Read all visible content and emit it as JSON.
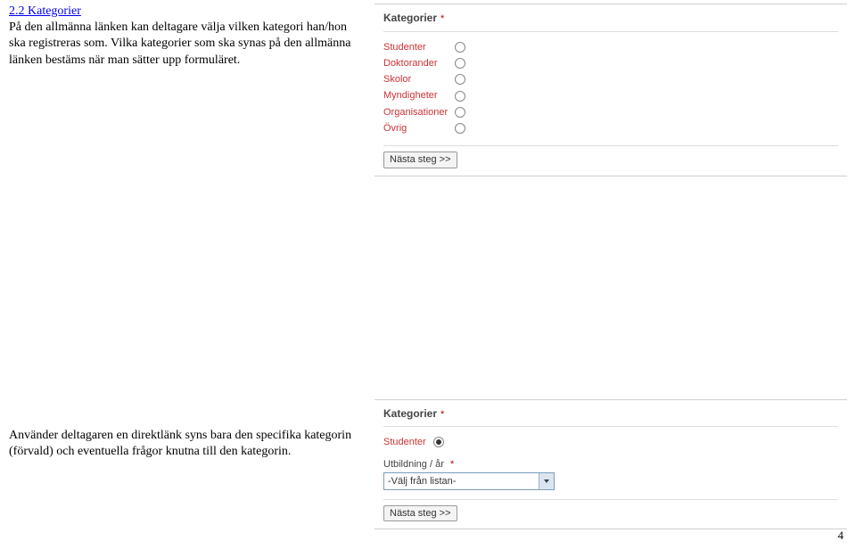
{
  "section_heading": "2.2 Kategorier",
  "paragraph1": "På den allmänna länken kan deltagare välja vilken kategori han/hon ska registreras som. Vilka kategorier som ska synas på den allmänna länken bestäms när man sätter upp formuläret.",
  "paragraph2": "Använder deltagaren en direktlänk syns bara den specifika kategorin (förvald) och eventuella frågor knutna till den kategorin.",
  "panel1": {
    "title": "Kategorier",
    "req": "*",
    "options": [
      "Studenter",
      "Doktorander",
      "Skolor",
      "Myndigheter",
      "Organisationer",
      "Övrig"
    ],
    "button": "Nästa steg >>"
  },
  "panel2": {
    "title": "Kategorier",
    "req": "*",
    "selected": "Studenter",
    "field_label": "Utbildning / år",
    "field_req": "*",
    "select_value": "-Välj från listan-",
    "button": "Nästa steg >>"
  },
  "page_number": "4"
}
